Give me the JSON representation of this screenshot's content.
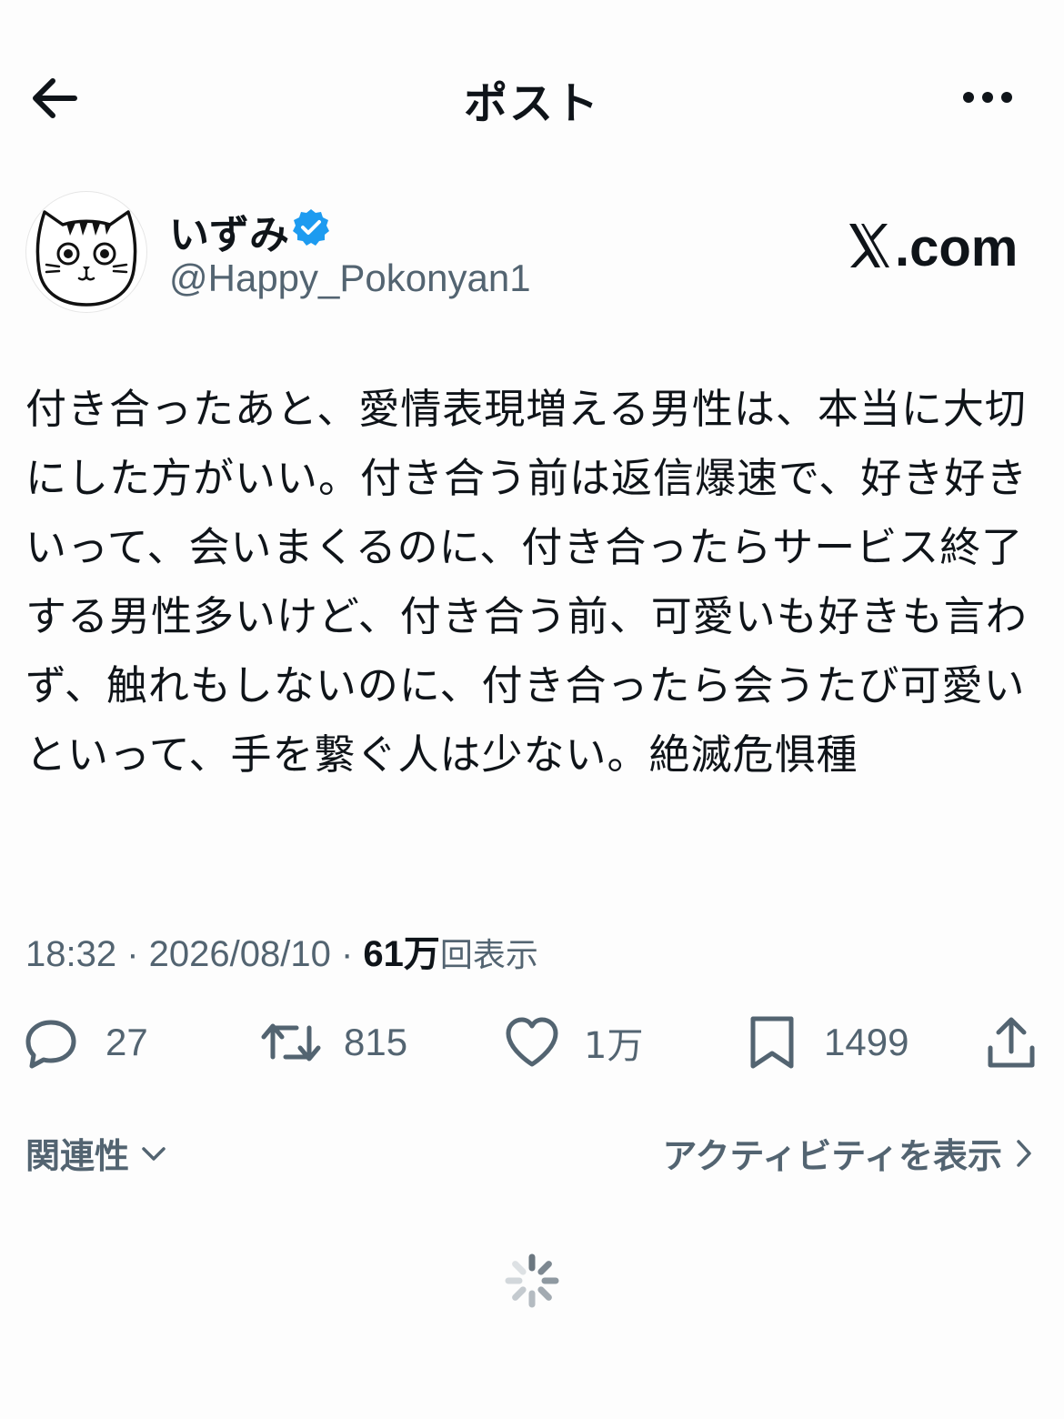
{
  "header": {
    "title": "ポスト",
    "back_icon": "back-arrow-icon",
    "more_icon": "more-dots-icon"
  },
  "author": {
    "name": "いずみ",
    "handle": "@Happy_Pokonyan1",
    "verified": true,
    "avatar": "cat-avatar"
  },
  "brand": {
    "label": ".com"
  },
  "post": {
    "text": "付き合ったあと、愛情表現増える男性は、本当に大切にした方がいい。付き合う前は返信爆速で、好き好きいって、会いまくるのに、付き合ったらサービス終了する男性多いけど、付き合う前、可愛いも好きも言わず、触れもしないのに、付き合ったら会うたび可愛いといって、手を繋ぐ人は少ない。絶滅危惧種"
  },
  "meta": {
    "time": "18:32",
    "date": "2026/08/10",
    "separator": " · ",
    "views_count": "61万",
    "views_label": "回表示"
  },
  "actions": {
    "replies": "27",
    "reposts": "815",
    "likes": "1万",
    "bookmarks": "1499"
  },
  "footer": {
    "relevance_label": "関連性",
    "activity_label": "アクティビティを表示"
  },
  "colors": {
    "text_primary": "#0f1419",
    "text_secondary": "#536471",
    "verified_blue": "#1d9bf0",
    "background": "#fdfdfd"
  }
}
